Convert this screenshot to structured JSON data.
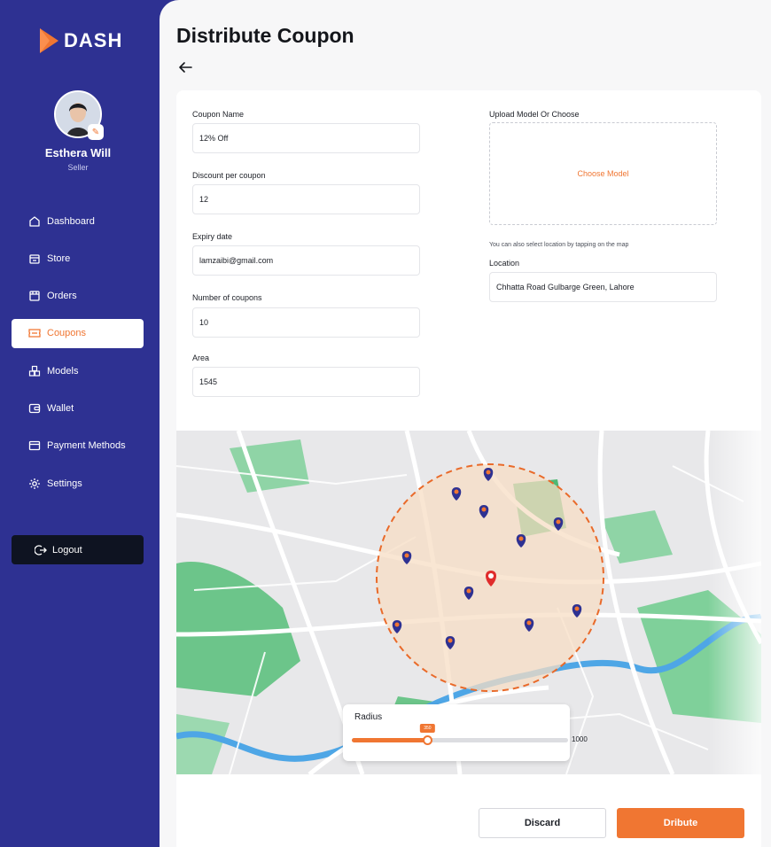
{
  "brand": {
    "name": "DASH",
    "accent": "#f07632",
    "sidebar_bg": "#2e3192"
  },
  "user": {
    "name": "Esthera Will",
    "role": "Seller"
  },
  "nav": {
    "items": [
      {
        "label": "Dashboard",
        "icon": "home-icon"
      },
      {
        "label": "Store",
        "icon": "store-icon"
      },
      {
        "label": "Orders",
        "icon": "orders-icon"
      },
      {
        "label": "Coupons",
        "icon": "coupon-icon",
        "active": true
      },
      {
        "label": "Models",
        "icon": "models-icon"
      },
      {
        "label": "Wallet",
        "icon": "wallet-icon"
      },
      {
        "label": "Payment Methods",
        "icon": "card-icon"
      },
      {
        "label": "Settings",
        "icon": "gear-icon"
      }
    ],
    "logout_label": "Logout"
  },
  "page": {
    "title": "Distribute Coupon"
  },
  "form": {
    "coupon_name": {
      "label": "Coupon Name",
      "value": "12% Off"
    },
    "discount": {
      "label": "Discount per coupon",
      "value": "12"
    },
    "expiry": {
      "label": "Expiry date",
      "value": "lamzaibi@gmail.com"
    },
    "count": {
      "label": "Number of coupons",
      "value": "10"
    },
    "area": {
      "label": "Area",
      "value": "1545"
    },
    "upload": {
      "label": "Upload Model Or Choose",
      "action": "Choose Model"
    },
    "hint": "You can also select location by tapping on the map",
    "location": {
      "label": "Location",
      "value": "Chhatta Road Gulbarge Green, Lahore"
    }
  },
  "map": {
    "radius": {
      "label": "Radius",
      "value": 350,
      "value_label": "350",
      "max_label": "1000",
      "min": 0,
      "max": 1000
    }
  },
  "actions": {
    "discard": "Discard",
    "submit": "Dribute"
  }
}
